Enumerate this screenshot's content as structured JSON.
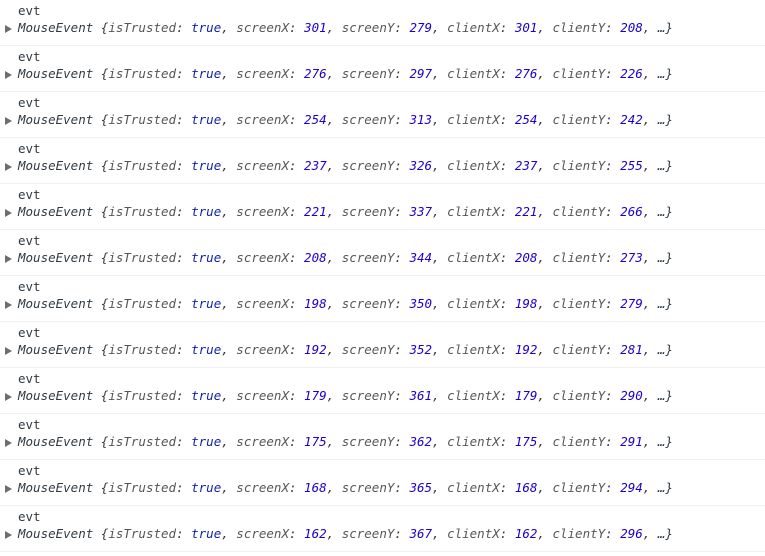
{
  "console": {
    "entries": [
      {
        "label": "evt",
        "class_name": "MouseEvent",
        "isTrusted": "true",
        "screenX": "301",
        "screenY": "279",
        "clientX": "301",
        "clientY": "208"
      },
      {
        "label": "evt",
        "class_name": "MouseEvent",
        "isTrusted": "true",
        "screenX": "276",
        "screenY": "297",
        "clientX": "276",
        "clientY": "226"
      },
      {
        "label": "evt",
        "class_name": "MouseEvent",
        "isTrusted": "true",
        "screenX": "254",
        "screenY": "313",
        "clientX": "254",
        "clientY": "242"
      },
      {
        "label": "evt",
        "class_name": "MouseEvent",
        "isTrusted": "true",
        "screenX": "237",
        "screenY": "326",
        "clientX": "237",
        "clientY": "255"
      },
      {
        "label": "evt",
        "class_name": "MouseEvent",
        "isTrusted": "true",
        "screenX": "221",
        "screenY": "337",
        "clientX": "221",
        "clientY": "266"
      },
      {
        "label": "evt",
        "class_name": "MouseEvent",
        "isTrusted": "true",
        "screenX": "208",
        "screenY": "344",
        "clientX": "208",
        "clientY": "273"
      },
      {
        "label": "evt",
        "class_name": "MouseEvent",
        "isTrusted": "true",
        "screenX": "198",
        "screenY": "350",
        "clientX": "198",
        "clientY": "279"
      },
      {
        "label": "evt",
        "class_name": "MouseEvent",
        "isTrusted": "true",
        "screenX": "192",
        "screenY": "352",
        "clientX": "192",
        "clientY": "281"
      },
      {
        "label": "evt",
        "class_name": "MouseEvent",
        "isTrusted": "true",
        "screenX": "179",
        "screenY": "361",
        "clientX": "179",
        "clientY": "290"
      },
      {
        "label": "evt",
        "class_name": "MouseEvent",
        "isTrusted": "true",
        "screenX": "175",
        "screenY": "362",
        "clientX": "175",
        "clientY": "291"
      },
      {
        "label": "evt",
        "class_name": "MouseEvent",
        "isTrusted": "true",
        "screenX": "168",
        "screenY": "365",
        "clientX": "168",
        "clientY": "294"
      },
      {
        "label": "evt",
        "class_name": "MouseEvent",
        "isTrusted": "true",
        "screenX": "162",
        "screenY": "367",
        "clientX": "162",
        "clientY": "296"
      }
    ],
    "keys": {
      "isTrusted": "isTrusted",
      "screenX": "screenX",
      "screenY": "screenY",
      "clientX": "clientX",
      "clientY": "clientY"
    },
    "ellipsis": "…",
    "expand_icon": "disclosure-triangle-right"
  }
}
